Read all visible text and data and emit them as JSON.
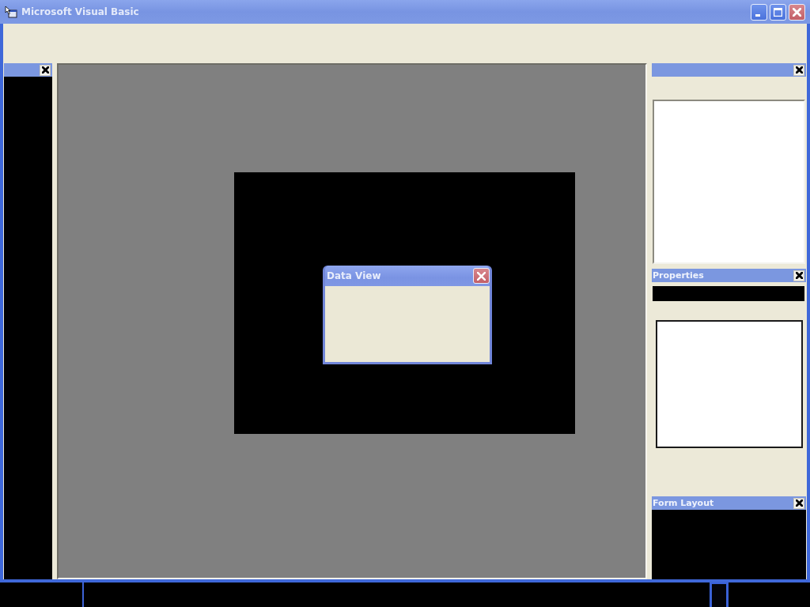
{
  "window": {
    "title": "Microsoft Visual Basic"
  },
  "dialog": {
    "title": "Data View"
  },
  "panels": [
    {
      "title": "Properties"
    },
    {
      "title": "Form Layout"
    }
  ]
}
